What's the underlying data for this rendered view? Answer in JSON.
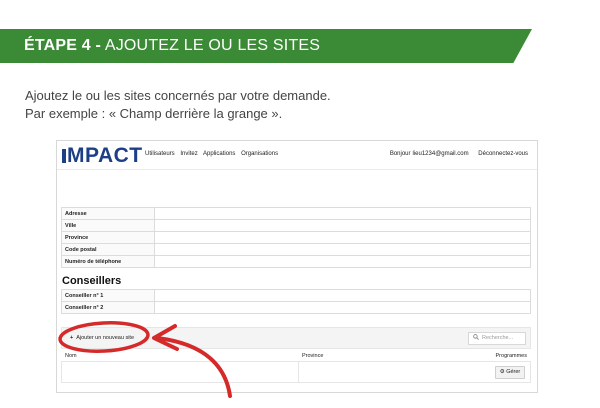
{
  "banner": {
    "step": "ÉTAPE 4 -",
    "title": "AJOUTEZ LE OU LES SITES"
  },
  "intro": {
    "line1": "Ajoutez le ou les sites concernés par votre demande.",
    "line2": "Par exemple : « Champ derrière la grange »."
  },
  "app": {
    "logo": "MPACT",
    "nav": [
      "Utilisateurs",
      "Invitez",
      "Applications",
      "Organisations"
    ],
    "greeting": "Bonjour",
    "email": "lieu1234@gmail.com",
    "logout": "Déconnectez-vous",
    "fields": [
      "Adresse",
      "Ville",
      "Province",
      "Code postal",
      "Numéro de téléphone"
    ],
    "advisors_title": "Conseillers",
    "advisors": [
      "Conseiller n° 1",
      "Conseiller n° 2"
    ],
    "add_site": "Ajouter un nouveau site",
    "search_placeholder": "Recherche...",
    "columns": {
      "name": "Nom",
      "province": "Province",
      "programs": "Programmes"
    },
    "manage": "Gérer"
  },
  "colors": {
    "banner": "#3b8a35",
    "logo": "#1d3f86",
    "annotation": "#d52a2a"
  },
  "icons": {
    "add": "plus-icon",
    "search": "search-icon",
    "manage": "gear-icon",
    "annotation": "arrow-icon"
  }
}
